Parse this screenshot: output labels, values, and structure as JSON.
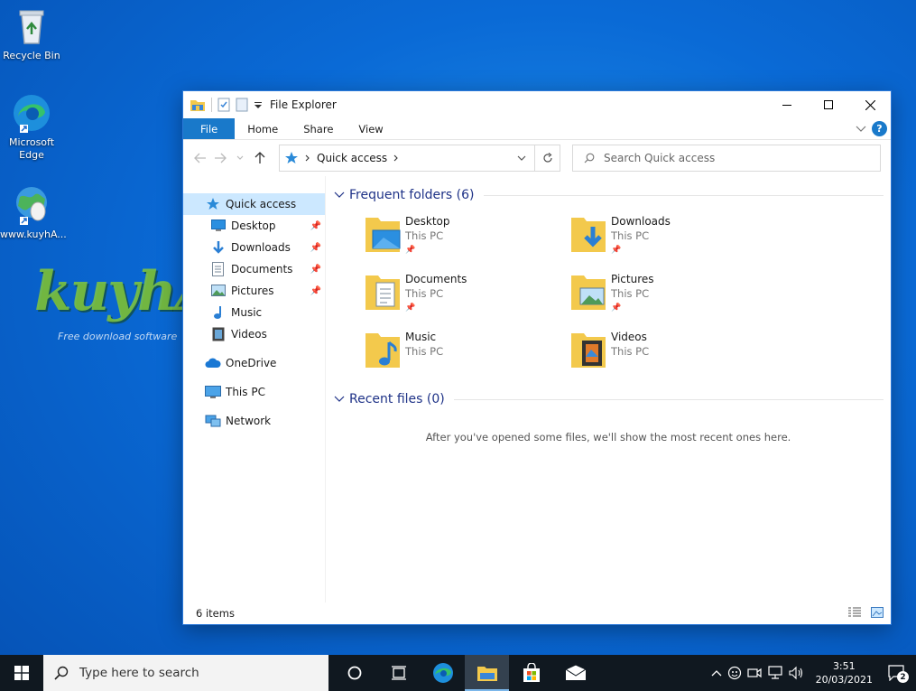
{
  "desktop": {
    "icons": [
      {
        "label": "Recycle Bin"
      },
      {
        "label": "Microsoft Edge"
      },
      {
        "label": "www.kuyhA..."
      }
    ],
    "watermark": {
      "brand": "kuyhAaMe",
      "tagline": "Free download software"
    }
  },
  "window": {
    "title": "File Explorer",
    "ribbon": {
      "file": "File",
      "home": "Home",
      "share": "Share",
      "view": "View",
      "help": "?"
    },
    "address": {
      "location": "Quick access"
    },
    "search": {
      "placeholder": "Search Quick access"
    },
    "nav": {
      "quick_access": "Quick access",
      "desktop": "Desktop",
      "downloads": "Downloads",
      "documents": "Documents",
      "pictures": "Pictures",
      "music": "Music",
      "videos": "Videos",
      "onedrive": "OneDrive",
      "this_pc": "This PC",
      "network": "Network"
    },
    "frequent": {
      "heading": "Frequent folders (6)",
      "items": [
        {
          "name": "Desktop",
          "location": "This PC",
          "pinned": true
        },
        {
          "name": "Downloads",
          "location": "This PC",
          "pinned": true
        },
        {
          "name": "Documents",
          "location": "This PC",
          "pinned": true
        },
        {
          "name": "Pictures",
          "location": "This PC",
          "pinned": true
        },
        {
          "name": "Music",
          "location": "This PC",
          "pinned": false
        },
        {
          "name": "Videos",
          "location": "This PC",
          "pinned": false
        }
      ]
    },
    "recent": {
      "heading": "Recent files (0)",
      "empty_message": "After you've opened some files, we'll show the most recent ones here."
    },
    "status": {
      "items": "6 items"
    }
  },
  "taskbar": {
    "search_placeholder": "Type here to search",
    "time": "3:51",
    "date": "20/03/2021",
    "notifications": "2"
  },
  "colors": {
    "accent": "#1979ca",
    "selection": "#cce8ff",
    "folder": "#f3c94c",
    "taskbar": "#101820"
  }
}
